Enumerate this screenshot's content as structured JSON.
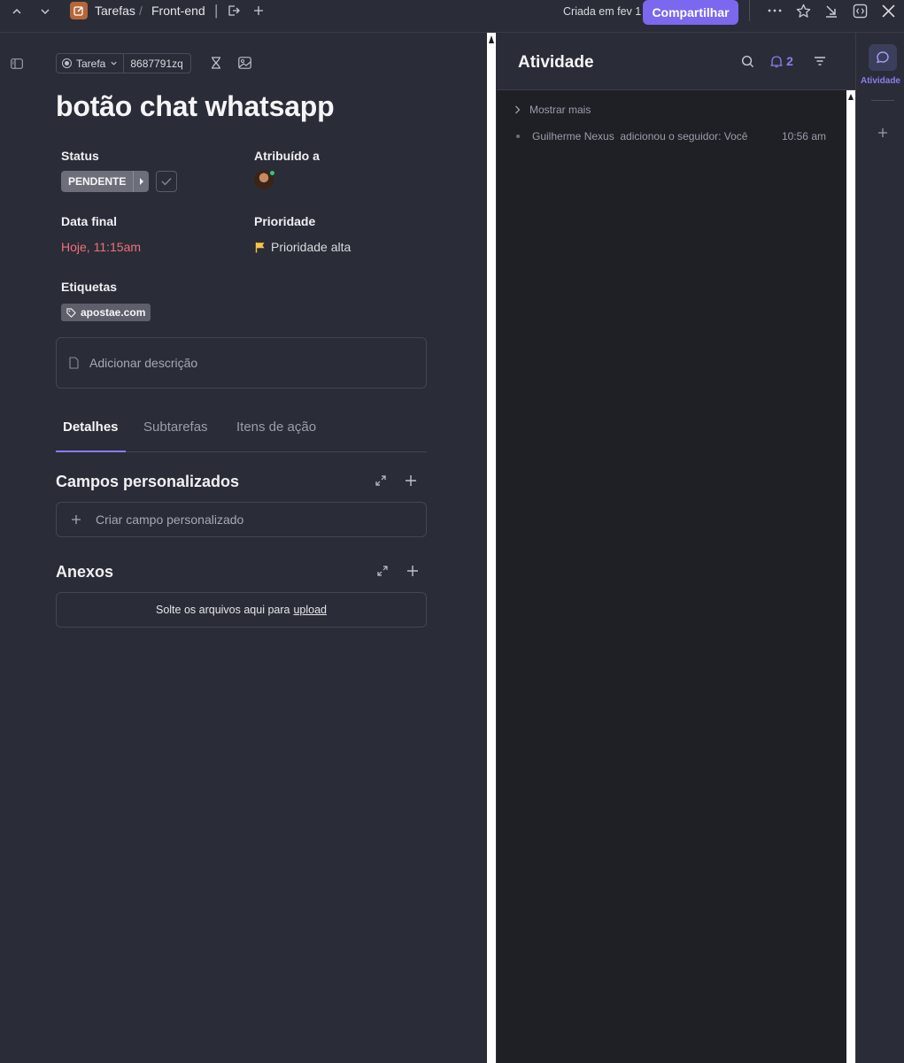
{
  "topbar": {
    "breadcrumb_space": "Tarefas",
    "breadcrumb_sep": "/",
    "breadcrumb_list": "Front-end",
    "pipe": "|",
    "created": "Criada em fev 1",
    "share_label": "Compartilhar",
    "accent": "#7b68ee"
  },
  "task": {
    "type_label": "Tarefa",
    "id": "8687791zq",
    "title": "botão chat whatsapp"
  },
  "fields": {
    "status_label": "Status",
    "status_value": "PENDENTE",
    "assigned_label": "Atribuído a",
    "due_label": "Data final",
    "due_value": "Hoje, 11:15am",
    "priority_label": "Prioridade",
    "priority_value": "Prioridade alta",
    "tags_label": "Etiquetas",
    "tag_value": "apostae.com"
  },
  "description": {
    "placeholder": "Adicionar descrição"
  },
  "tabs": [
    {
      "label": "Detalhes",
      "active": true
    },
    {
      "label": "Subtarefas",
      "active": false
    },
    {
      "label": "Itens de ação",
      "active": false
    }
  ],
  "custom_fields": {
    "title": "Campos personalizados",
    "create_label": "Criar campo personalizado"
  },
  "attachments": {
    "title": "Anexos",
    "drop_text": "Solte os arquivos aqui para",
    "upload_link": "upload"
  },
  "activity": {
    "title": "Atividade",
    "notification_count": "2",
    "show_more": "Mostrar mais",
    "entries": [
      {
        "text": "Guilherme Nexus  adicionou o seguidor: Você",
        "time": "10:56 am"
      }
    ]
  },
  "rail": {
    "activity_label": "Atividade"
  },
  "icons": {
    "nav_up": "chevron-up-icon",
    "nav_down": "chevron-down-icon",
    "space": "edit-square-icon",
    "move": "move-out-icon",
    "add": "plus-icon",
    "more": "ellipsis-icon",
    "star": "star-icon",
    "minimize": "minimize-arrow-icon",
    "layout": "split-view-icon",
    "close": "close-icon",
    "sidebar": "sidebar-toggle-icon",
    "hourglass": "hourglass-icon",
    "image": "image-icon",
    "flag": "flag-icon",
    "tag": "tag-icon",
    "doc": "document-icon",
    "expand": "expand-icon",
    "search": "search-icon",
    "bell": "bell-icon",
    "filter": "filter-icon",
    "chat": "chat-bubble-icon"
  }
}
